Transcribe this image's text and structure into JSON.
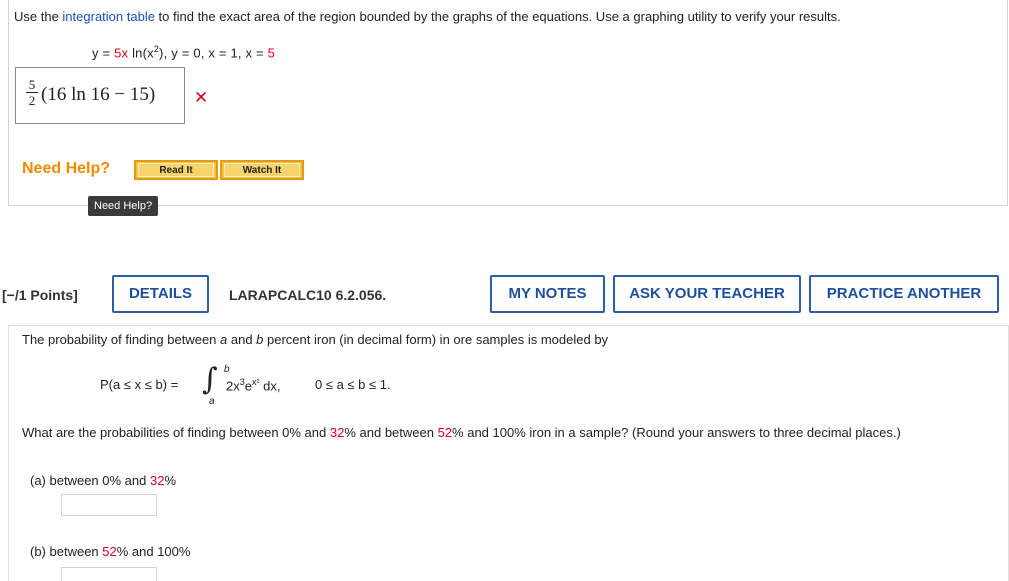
{
  "q1": {
    "text_before": "Use the ",
    "link": "integration table",
    "text_after": " to find the exact area of the region bounded by the graphs of the equations. Use a graphing utility to verify your results.",
    "eq_y": "y = ",
    "eq_5x": "5x",
    "eq_ln": " ln(x",
    "eq_sup": "2",
    "eq_rest": "),  y = 0,  x = 1,  x = ",
    "eq_5": "5",
    "answer_num": "5",
    "answer_den": "2",
    "answer_expr": "(16 ln 16 − 15)",
    "wrong_mark": "✕"
  },
  "help": {
    "label": "Need Help?",
    "read_it": "Read It",
    "watch_it": "Watch It",
    "tooltip": "Need Help?"
  },
  "q2_header": {
    "points": "[−/1 Points]",
    "details": "DETAILS",
    "course_code": "LARAPCALC10 6.2.056.",
    "my_notes": "MY NOTES",
    "ask_teacher": "ASK YOUR TEACHER",
    "practice": "PRACTICE ANOTHER"
  },
  "q2": {
    "intro_1": "The probability of finding between ",
    "intro_a": "a",
    "intro_2": " and ",
    "intro_b": "b",
    "intro_3": " percent iron (in decimal form) in ore samples is modeled by",
    "lhs": "P(a ≤ x ≤ b) =",
    "upper": "b",
    "lower": "a",
    "integrand_1": "2x",
    "integrand_sup1": "3",
    "integrand_2": "e",
    "integrand_sup2": "x²",
    "integrand_3": " dx,",
    "domain": "0 ≤ a ≤ b ≤ 1.",
    "question_1": "What are the probabilities of finding between 0% and ",
    "question_32": "32",
    "question_2": "% and between ",
    "question_52": "52",
    "question_3": "% and 100% iron in a sample? (Round your answers to three decimal places.)",
    "part_a_label": "(a)   between 0% and ",
    "part_a_val": "32",
    "part_a_pct": "%",
    "part_b_label": "(b)   between ",
    "part_b_val": "52",
    "part_b_rest": "% and 100%"
  }
}
